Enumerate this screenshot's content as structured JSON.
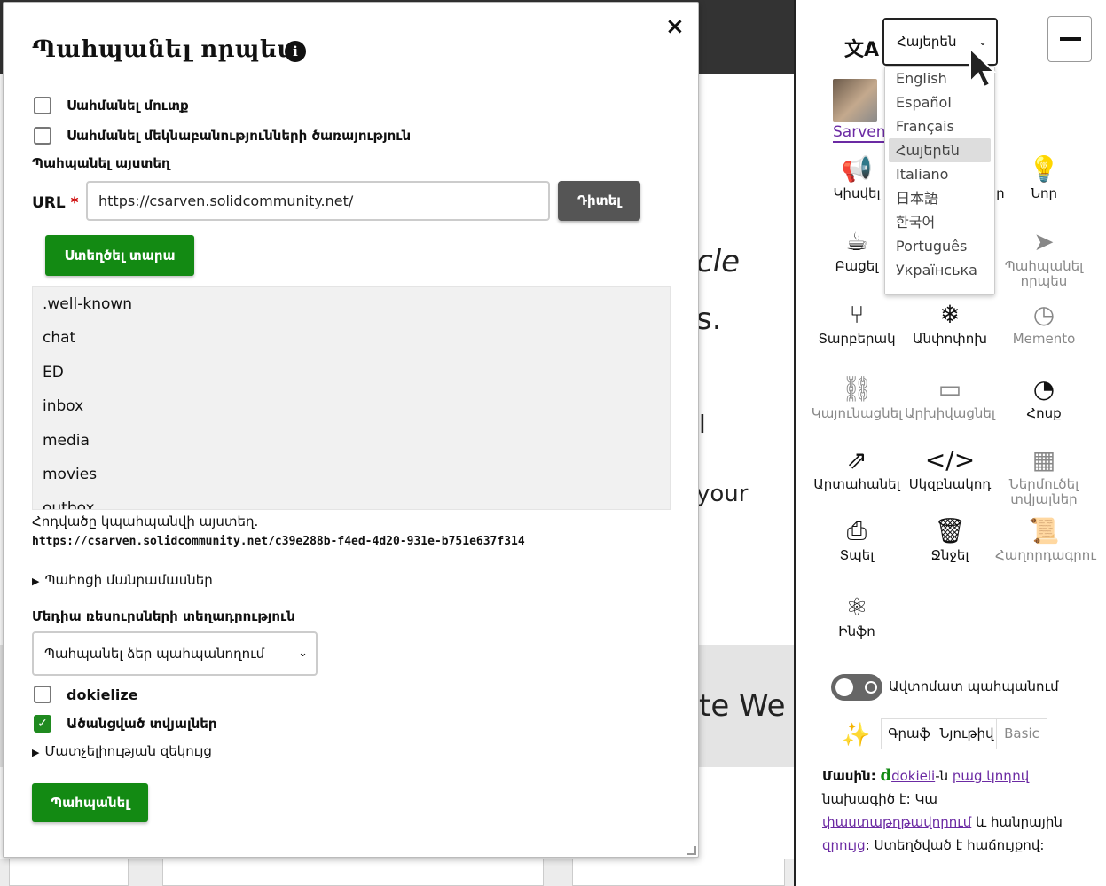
{
  "background": {
    "fragments": [
      "cle",
      "s.",
      "l",
      "your",
      "te We"
    ]
  },
  "modal": {
    "title": "Պահպանել որպես",
    "close": "×",
    "info_icon": "i",
    "checkboxes": {
      "set_access": "Սահմանել մուտք",
      "set_comment_service": "Սահմանել մեկնաբանությունների ծառայություն"
    },
    "save_here_label": "Պահպանել այստեղ",
    "url_label": "URL",
    "url_required": "*",
    "url_value": "https://csarven.solidcommunity.net/",
    "browse_button": "Դիտել",
    "create_container_button": "Ստեղծել տարա",
    "tree_items": [
      ".well-known",
      "chat",
      "ED",
      "inbox",
      "media",
      "movies",
      "outbox"
    ],
    "saved_at_text": "Հոդվածը կպահպանվի այստեղ.",
    "saved_at_url": "https://csarven.solidcommunity.net/c39e288b-f4ed-4d20-931e-b751e637f314",
    "storage_details": "Պահոցի մանրամասներ",
    "media_location_label": "Մեդիա ռեսուրսների տեղադրություն",
    "media_select_value": "Պահպանել ձեր պահպանողում",
    "dokielize_label": "dokielize",
    "derived_data_label": "Ածանցված տվյալներ",
    "accessibility_report": "Մատչելիության զեկույց",
    "save_button": "Պահպանել"
  },
  "sidebar": {
    "language_select": "Հայերեն",
    "language_options": [
      "English",
      "Español",
      "Français",
      "Հայերեն",
      "Italiano",
      "日本語",
      "한국어",
      "Português",
      "Українська"
    ],
    "user_name": "Sarven",
    "tools": [
      {
        "label": "Կիսվել",
        "icon": "megaphone-icon",
        "glyph": "📢"
      },
      {
        "label": "Ծանուցումներ",
        "icon": "bolt-icon",
        "glyph": "⚡"
      },
      {
        "label": "Նոր",
        "icon": "lightbulb-icon",
        "glyph": "💡"
      },
      {
        "label": "Բացել",
        "icon": "coffee-icon",
        "glyph": "☕"
      },
      {
        "label": "Պահպանել",
        "icon": "lifebuoy-icon",
        "glyph": "⊕"
      },
      {
        "label": "Պահպանել որպես",
        "icon": "paper-plane-icon",
        "glyph": "➤"
      },
      {
        "label": "Տարբերակ",
        "icon": "branch-icon",
        "glyph": "⑂"
      },
      {
        "label": "Անփոփոխ",
        "icon": "snowflake-icon",
        "glyph": "❄"
      },
      {
        "label": "Memento",
        "icon": "clock-icon",
        "glyph": "◷"
      },
      {
        "label": "Կայունացնել",
        "icon": "link-icon",
        "glyph": "⛓"
      },
      {
        "label": "Արխիվացնել",
        "icon": "archive-icon",
        "glyph": "▭"
      },
      {
        "label": "Հոսք",
        "icon": "rss-icon",
        "glyph": "◔"
      },
      {
        "label": "Արտահանել",
        "icon": "external-link-icon",
        "glyph": "⇗"
      },
      {
        "label": "Սկզբնակոդ",
        "icon": "code-icon",
        "glyph": "</>"
      },
      {
        "label": "Ներմուծել տվյալներ",
        "icon": "table-icon",
        "glyph": "▦"
      },
      {
        "label": "Տպել",
        "icon": "printer-icon",
        "glyph": "⎙"
      },
      {
        "label": "Ջնջել",
        "icon": "trash-icon",
        "glyph": "🗑"
      },
      {
        "label": "Հաղորդագրու",
        "icon": "scroll-icon",
        "glyph": "📜"
      },
      {
        "label": "Ինֆո",
        "icon": "atom-icon",
        "glyph": "⚛"
      }
    ],
    "autosave_label": "Ավտոմատ պահպանում",
    "mode_buttons": [
      "Գրաֆ",
      "Նյութիվ",
      "Basic"
    ],
    "about": {
      "heading": "Մասին:",
      "dokieli_mark": "d",
      "dokieli_link": "dokieli",
      "text1": "-ն",
      "open_source_link": "բաց կոդով",
      "text2": "նախագիծ է: Կա",
      "docs_link": "փաստաթղթավորում",
      "text3": "և հանրային",
      "chat_link": "զրույց",
      "text4": ": Ստեղծված է հաճույքով:"
    }
  },
  "colors": {
    "primary_green": "#138a13",
    "link_purple": "#6b2aa3",
    "dark_header": "#333333"
  }
}
